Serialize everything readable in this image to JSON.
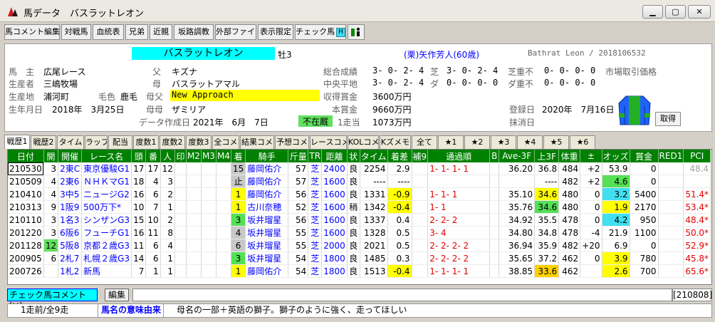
{
  "window": {
    "title": "馬データ　バスラットレオン"
  },
  "toolbar": [
    "馬コメント編集",
    "対戦馬",
    "血統表",
    "兄弟",
    "近親",
    "坂路調教",
    "外部ファイル",
    "表示限定",
    "チェック馬",
    "H"
  ],
  "horse": {
    "name": "バスラットレオン",
    "sex_age": "牡3",
    "trainer": "(栗)矢作芳人(60歳)",
    "roman": "Bathrat Leon / 2018106532",
    "owner_label": "馬　主",
    "owner": "広尾レース",
    "breeder_label": "生産者",
    "breeder": "三嶋牧場",
    "birthplace_label": "生産地",
    "birthplace": "浦河町",
    "color_label": "毛色",
    "color": "鹿毛",
    "birthdate_label": "生年月日",
    "birthdate": "2018年　3月25日",
    "sire_label": "父",
    "sire": "キズナ",
    "dam_label": "母",
    "dam": "バスラットアマル",
    "damsire_label": "母父",
    "damsire": "New Approach",
    "damdam_label": "母母",
    "damdam": "ザミリア",
    "created_label": "データ作成日",
    "created": "2021年　6月　7日",
    "status": "不在厩",
    "total_label": "総合成績",
    "total": "3- 0- 2- 4",
    "turf_label": "芝",
    "turf": "3- 0- 2- 4",
    "turf_heavy_label": "芝重不",
    "turf_heavy": "0- 0- 0- 0",
    "central_label": "中央平地",
    "central": "3- 0- 2- 4",
    "dirt_label": "ダ",
    "dirt": "0- 0- 0- 0",
    "dirt_heavy_label": "ダ重不",
    "dirt_heavy": "0- 0- 0- 0",
    "market_label": "市場取引価格",
    "prize_label": "収得賞金",
    "prize": "3600万円",
    "main_prize_label": "本賞金",
    "main_prize": "9660万円",
    "per_label": "1走当",
    "per": "1073万円",
    "reg_label": "登録日",
    "reg": "2020年　7月16日",
    "del_label": "抹消日",
    "get_button": "取得"
  },
  "tabs": [
    "戦歴1",
    "戦歴2",
    "タイム",
    "ラップ",
    "配当",
    "度数1",
    "度数2",
    "度数3",
    "全コメ",
    "結果コメ",
    "予想コメ",
    "レースコメ",
    "KOLコメ",
    "Kズメモ",
    "全て",
    "★1",
    "★2",
    "★3",
    "★4",
    "★5",
    "★6"
  ],
  "columns": [
    "日付",
    "開",
    "開催",
    "レース名",
    "頭",
    "番",
    "人",
    "印",
    "M2",
    "M3",
    "M4",
    "着",
    "騎手",
    "斤量",
    "TR",
    "距離",
    "状",
    "タイム",
    "着差",
    "補9",
    "通過順",
    "B",
    "Ave-3F",
    "上3F",
    "体重",
    "±",
    "オッズ",
    "賞金",
    "RED1",
    "PCI"
  ],
  "races": [
    [
      "210530",
      "3",
      "2東C",
      "東京優駿G1",
      "17",
      "17",
      "12",
      "",
      "",
      "",
      "",
      "15",
      "藤岡佑介",
      "57",
      "芝",
      "2400",
      "良",
      "2254",
      "2.9",
      "",
      "1- 1- 1- 1",
      "",
      "36.20",
      "36.8",
      "484",
      "+2",
      "53.9",
      "0",
      "",
      "48.4"
    ],
    [
      "210509",
      "4",
      "2東6",
      "ＮＨＫマG1",
      "18",
      "4",
      "3",
      "",
      "",
      "",
      "",
      "止",
      "藤岡佑介",
      "57",
      "芝",
      "1600",
      "良",
      "----",
      "----",
      "",
      "",
      "",
      "",
      "----",
      "482",
      "+2",
      "4.6",
      "0",
      "",
      ""
    ],
    [
      "210410",
      "4",
      "3中5",
      "ニュージG2",
      "16",
      "6",
      "2",
      "",
      "",
      "",
      "",
      "1",
      "藤岡佑介",
      "56",
      "芝",
      "1600",
      "良",
      "1331",
      "-0.9",
      "",
      "1- 1- 1",
      "",
      "35.10",
      "34.6",
      "480",
      "0",
      "3.2",
      "5400",
      "",
      "51.4*"
    ],
    [
      "210313",
      "9",
      "1阪9",
      "500万下*",
      "10",
      "7",
      "1",
      "",
      "",
      "",
      "",
      "1",
      "古川奈穂",
      "52",
      "芝",
      "1600",
      "稍",
      "1342",
      "-0.4",
      "",
      "1- 1",
      "",
      "35.76",
      "34.6",
      "480",
      "0",
      "1.9",
      "2170",
      "",
      "53.4*"
    ],
    [
      "210110",
      "3",
      "1名3",
      "シンザンG3",
      "15",
      "10",
      "2",
      "",
      "",
      "",
      "",
      "3",
      "坂井瑠星",
      "56",
      "芝",
      "1600",
      "良",
      "1337",
      "0.4",
      "",
      "2- 2- 2",
      "",
      "34.92",
      "35.5",
      "478",
      "0",
      "4.2",
      "950",
      "",
      "48.4*"
    ],
    [
      "201220",
      "3",
      "6阪6",
      "フューチG1",
      "16",
      "11",
      "8",
      "",
      "",
      "",
      "",
      "4",
      "坂井瑠星",
      "55",
      "芝",
      "1600",
      "良",
      "1328",
      "0.5",
      "",
      "3- 4",
      "",
      "34.80",
      "34.8",
      "478",
      "-4",
      "21.9",
      "1100",
      "",
      "50.0*"
    ],
    [
      "201128",
      "12",
      "5阪8",
      "京都２歳G3",
      "11",
      "6",
      "4",
      "",
      "",
      "",
      "",
      "6",
      "坂井瑠星",
      "55",
      "芝",
      "2000",
      "良",
      "2021",
      "0.5",
      "",
      "2- 2- 2- 2",
      "",
      "36.94",
      "35.9",
      "482",
      "+20",
      "6.9",
      "0",
      "",
      "52.9*"
    ],
    [
      "200905",
      "6",
      "2札7",
      "札幌２歳G3",
      "14",
      "6",
      "1",
      "",
      "",
      "",
      "",
      "3",
      "坂井瑠星",
      "54",
      "芝",
      "1800",
      "良",
      "1485",
      "0.3",
      "",
      "2- 2- 2- 2",
      "",
      "35.65",
      "37.2",
      "462",
      "0",
      "3.9",
      "780",
      "",
      "45.8*"
    ],
    [
      "200726",
      "",
      "1札2",
      "新馬",
      "7",
      "1",
      "1",
      "",
      "",
      "",
      "",
      "1",
      "藤岡佑介",
      "54",
      "芝",
      "1800",
      "良",
      "1513",
      "-0.4",
      "",
      "1- 1- 1- 1",
      "",
      "38.85",
      "33.6",
      "462",
      "",
      "2.6",
      "700",
      "",
      "65.6*"
    ]
  ],
  "bottom": {
    "check_label": "チェック馬コメント[H]",
    "edit": "編集",
    "date": "[210808]",
    "runs": "1走前/全9走",
    "origin_label": "馬名の意味由来",
    "origin": "母名の一部＋英語の獅子。獅子のように強く、走ってほしい"
  },
  "colors": {
    "header_green": "#008000",
    "name_bg": "#00ffff",
    "highlight_yellow": "#ffff00"
  }
}
